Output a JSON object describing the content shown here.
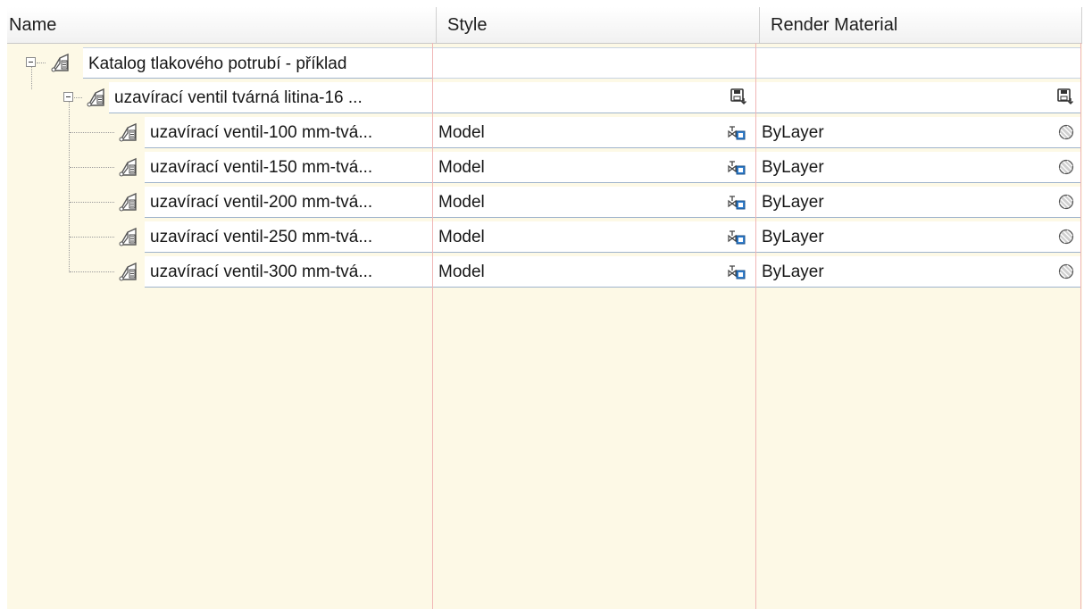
{
  "columns": {
    "name": "Name",
    "style": "Style",
    "render_material": "Render Material"
  },
  "tree": {
    "root": {
      "label": "Katalog tlakového potrubí - příklad",
      "expander_icon": "minus-box",
      "icon": "part-catalog-icon"
    },
    "group": {
      "label": "uzavírací ventil tvárná litina-16 ...",
      "expander_icon": "minus-box",
      "icon": "part-family-icon",
      "style_icon": "save-icon",
      "material_icon": "save-icon"
    },
    "rows": [
      {
        "label": "uzavírací ventil-100 mm-tvá...",
        "style": "Model",
        "material": "ByLayer"
      },
      {
        "label": "uzavírací ventil-150 mm-tvá...",
        "style": "Model",
        "material": "ByLayer"
      },
      {
        "label": "uzavírací ventil-200 mm-tvá...",
        "style": "Model",
        "material": "ByLayer"
      },
      {
        "label": "uzavírací ventil-250 mm-tvá...",
        "style": "Model",
        "material": "ByLayer"
      },
      {
        "label": "uzavírací ventil-300 mm-tvá...",
        "style": "Model",
        "material": "ByLayer"
      }
    ],
    "row_icons": {
      "part": "part-size-icon",
      "style": "valve-style-icon",
      "material": "material-sphere-icon"
    }
  },
  "colors": {
    "background": "#fdf9e6",
    "column_separator": "#f0b6b6",
    "row_border": "#9fb4cc",
    "header_bg": "#f4f4f4"
  }
}
